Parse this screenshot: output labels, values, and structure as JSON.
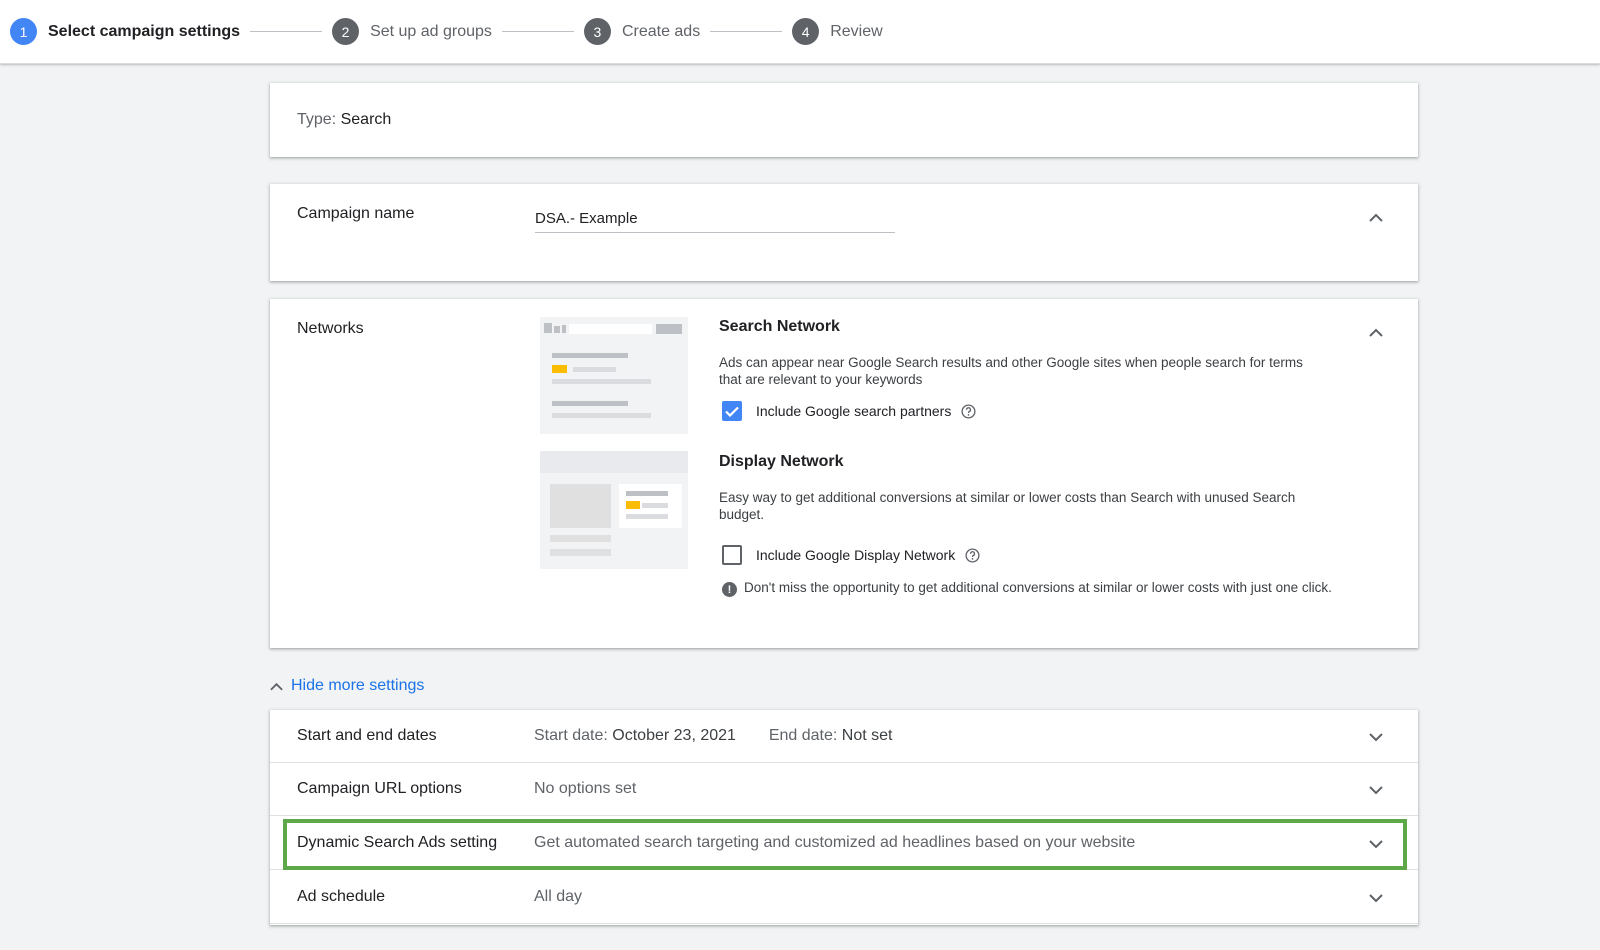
{
  "stepper": {
    "steps": [
      {
        "num": "1",
        "label": "Select campaign settings"
      },
      {
        "num": "2",
        "label": "Set up ad groups"
      },
      {
        "num": "3",
        "label": "Create ads"
      },
      {
        "num": "4",
        "label": "Review"
      }
    ]
  },
  "type_card": {
    "label": "Type:",
    "value": "Search"
  },
  "campaign_name": {
    "label": "Campaign name",
    "value": "DSA.- Example"
  },
  "networks": {
    "label": "Networks",
    "search": {
      "title": "Search Network",
      "desc": "Ads can appear near Google Search results and other Google sites when people search for terms that are relevant to your keywords",
      "checkbox_label": "Include Google search partners",
      "checked": true
    },
    "display": {
      "title": "Display Network",
      "desc": "Easy way to get additional conversions at similar or lower costs than Search with unused Search budget.",
      "checkbox_label": "Include Google Display Network",
      "checked": false
    },
    "notice": "Don't miss the opportunity to get additional conversions at similar or lower costs with just one click."
  },
  "more_settings": {
    "label": "Hide more settings"
  },
  "settings": {
    "dates": {
      "label": "Start and end dates",
      "start_prefix": "Start date:",
      "start_value": "October 23, 2021",
      "end_prefix": "End date:",
      "end_value": "Not set"
    },
    "url_options": {
      "label": "Campaign URL options",
      "value": "No options set"
    },
    "dsa": {
      "label": "Dynamic Search Ads setting",
      "value": "Get automated search targeting and customized ad headlines based on your website"
    },
    "schedule": {
      "label": "Ad schedule",
      "value": "All day"
    }
  },
  "colors": {
    "accent": "#4285f4",
    "link": "#1a73e8",
    "highlight": "#5ea84a",
    "yellow": "#fbbc04"
  },
  "icons": {
    "collapse": "chevron-up-icon",
    "expand": "chevron-down-icon",
    "help": "help-circle-icon",
    "info": "exclamation-circle-icon",
    "check": "check-icon"
  }
}
